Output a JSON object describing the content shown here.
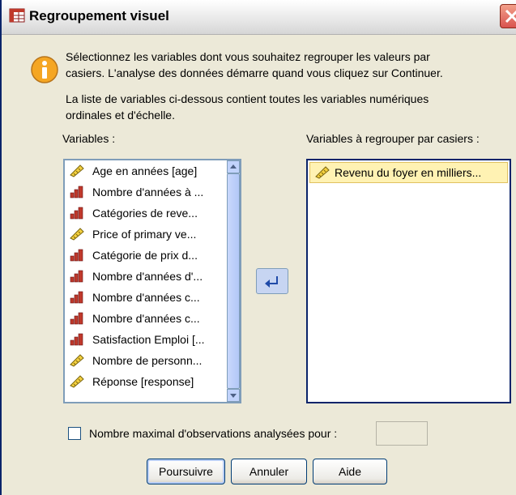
{
  "window": {
    "title": "Regroupement visuel"
  },
  "intro": {
    "line1": "Sélectionnez les variables dont vous souhaitez regrouper les valeurs par",
    "line2": "casiers. L'analyse des données démarre quand vous cliquez sur Continuer.",
    "note1": "La liste de variables ci-dessous contient toutes les variables numériques",
    "note2": "ordinales et d'échelle."
  },
  "source": {
    "label": "Variables :",
    "items": [
      {
        "label": "Age en années [age]",
        "icon": "scale-ruler-icon"
      },
      {
        "label": "Nombre d'années à ...",
        "icon": "ordinal-bars-icon"
      },
      {
        "label": "Catégories de reve...",
        "icon": "ordinal-bars-icon"
      },
      {
        "label": "Price of primary ve...",
        "icon": "scale-ruler-icon"
      },
      {
        "label": "Catégorie de prix d...",
        "icon": "ordinal-bars-icon"
      },
      {
        "label": "Nombre d'années d'...",
        "icon": "ordinal-bars-icon"
      },
      {
        "label": "Nombre d'années c...",
        "icon": "ordinal-bars-icon"
      },
      {
        "label": "Nombre d'années c...",
        "icon": "ordinal-bars-icon"
      },
      {
        "label": "Satisfaction Emploi [...",
        "icon": "ordinal-bars-icon"
      },
      {
        "label": "Nombre de personn...",
        "icon": "scale-ruler-icon"
      },
      {
        "label": "Réponse [response]",
        "icon": "scale-ruler-icon"
      }
    ]
  },
  "target": {
    "label": "Variables à regrouper par casiers :",
    "items": [
      {
        "label": "Revenu du foyer en milliers...",
        "icon": "scale-ruler-icon",
        "selected": true
      }
    ]
  },
  "max_cases": {
    "label": "Nombre maximal d'observations analysées pour :",
    "checked": false,
    "value": ""
  },
  "buttons": {
    "continue": "Poursuivre",
    "cancel": "Annuler",
    "help": "Aide"
  },
  "colors": {
    "selection": "#fff2b3",
    "title_bar": "#e7e7e7",
    "dialog_bg": "#ece9d8"
  }
}
